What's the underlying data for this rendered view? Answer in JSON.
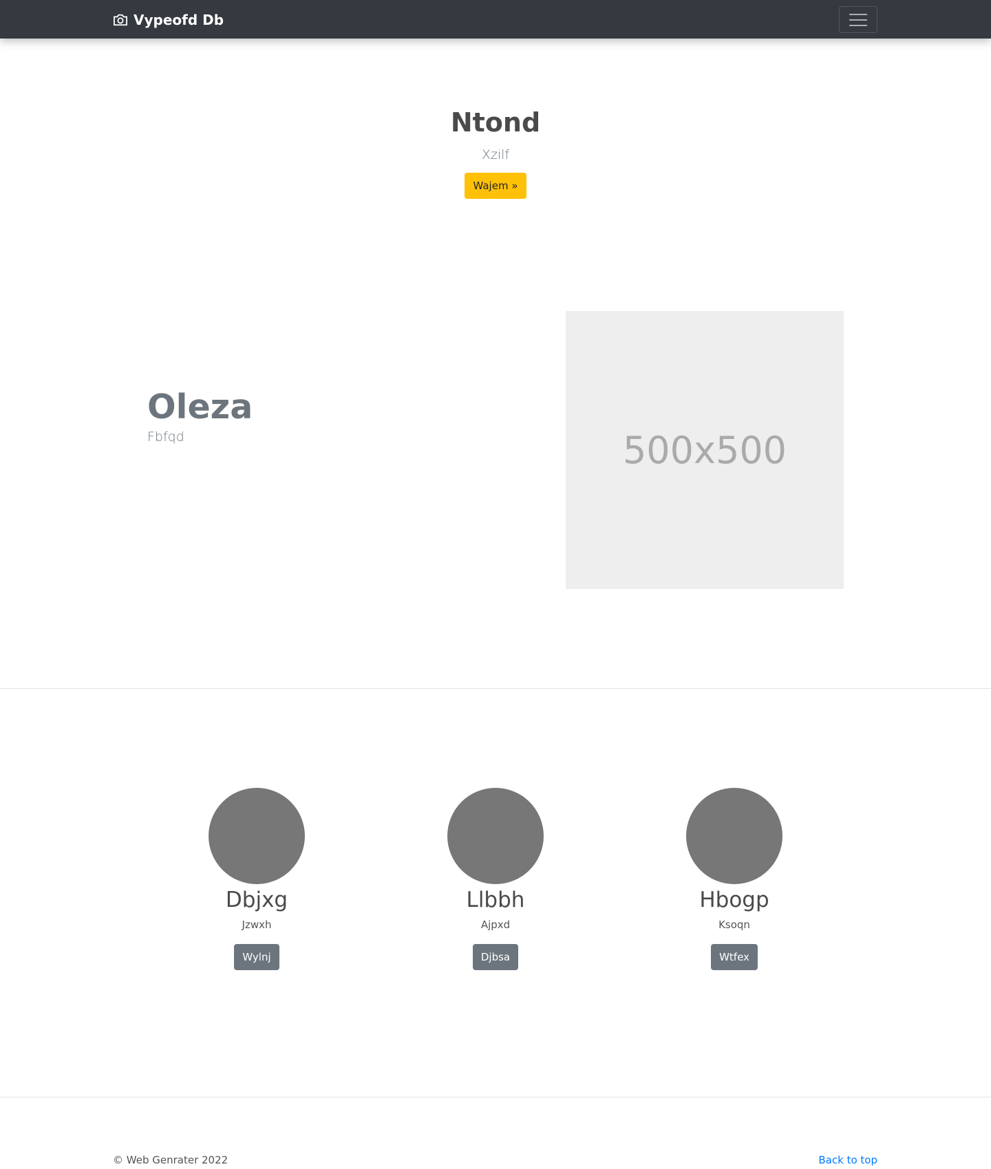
{
  "navbar": {
    "brand": "Vypeofd Db",
    "brand_icon": "camera-icon",
    "toggler_icon": "hamburger-menu-icon"
  },
  "hero": {
    "title": "Ntond",
    "subtitle": "Xzilf",
    "button_label": "Wajem »"
  },
  "feature": {
    "heading": "Oleza",
    "subheading": "Fbfqd",
    "image_placeholder": "500x500"
  },
  "team": [
    {
      "name": "Dbjxg",
      "role": "Jzwxh",
      "button": "Wylnj"
    },
    {
      "name": "Llbbh",
      "role": "Ajpxd",
      "button": "Djbsa"
    },
    {
      "name": "Hbogp",
      "role": "Ksoqn",
      "button": "Wtfex"
    }
  ],
  "footer": {
    "copyright": "© Web Genrater 2022",
    "back_to_top": "Back to top"
  },
  "colors": {
    "navbar_bg": "#343a40",
    "warning": "#ffc107",
    "secondary": "#6c757d",
    "link": "#007bff",
    "avatar": "#777777",
    "placeholder_bg": "#eeeeee"
  }
}
